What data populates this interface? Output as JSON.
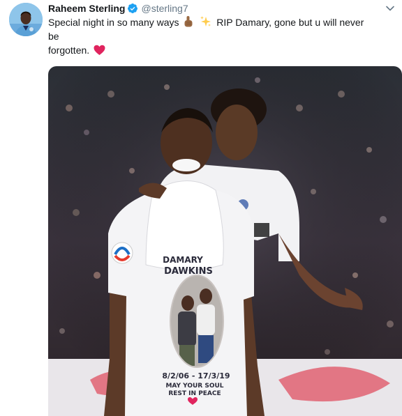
{
  "tweet": {
    "author": {
      "display_name": "Raheem Sterling",
      "handle": "@sterling7",
      "verified": true
    },
    "text_line1": "Special night in so many ways",
    "text_after_emoji": "RIP Damary, gone but u will never be",
    "text_line2": "forgotten.",
    "emojis": [
      "index-pointing-up-medium-dark-skin-tone",
      "sparkles",
      "red-heart"
    ],
    "media": {
      "shirt_name_partial": "DAMARY",
      "shirt_surname": "DAWKINS",
      "shirt_dates": "8/2/06 - 17/3/19",
      "shirt_message_line1": "MAY YOUR SOUL",
      "shirt_message_line2": "REST IN PEACE"
    }
  },
  "colors": {
    "verified_blue": "#1da1f2",
    "handle_grey": "#657786",
    "heart_red": "#e0245e"
  }
}
